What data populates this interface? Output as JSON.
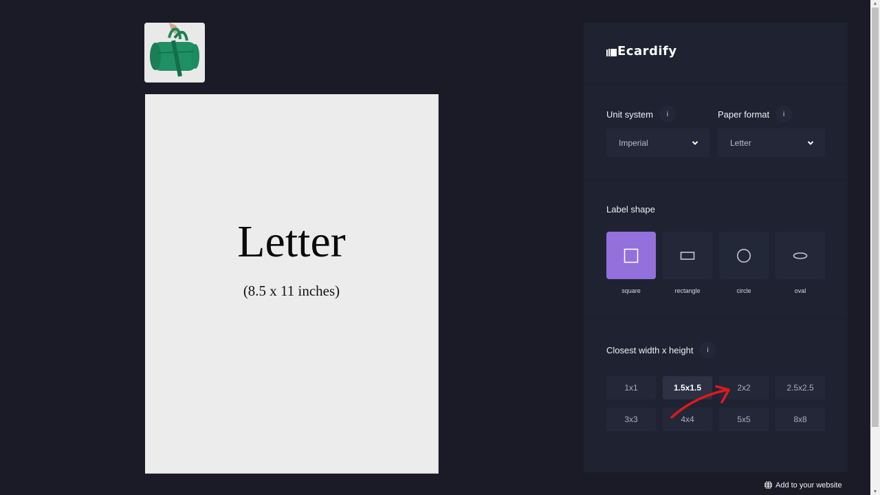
{
  "preview": {
    "thumbnail_alt": "green duffel bag product image",
    "paper_name": "Letter",
    "paper_dimensions": "(8.5 x 11 inches)"
  },
  "panel": {
    "brand": "Ecardify",
    "unit_system": {
      "label": "Unit system",
      "info": "i",
      "value": "Imperial"
    },
    "paper_format": {
      "label": "Paper format",
      "info": "i",
      "value": "Letter"
    },
    "label_shape": {
      "label": "Label shape",
      "selected": "square",
      "options": [
        {
          "id": "square",
          "label": "square"
        },
        {
          "id": "rectangle",
          "label": "rectangle"
        },
        {
          "id": "circle",
          "label": "circle"
        },
        {
          "id": "oval",
          "label": "oval"
        }
      ]
    },
    "closest_size": {
      "label": "Closest width x height",
      "info": "i",
      "selected": "1.5x1.5",
      "options": [
        "1x1",
        "1.5x1.5",
        "2x2",
        "2.5x2.5",
        "3x3",
        "4x4",
        "5x5",
        "8x8"
      ]
    },
    "accent_color": "#9370db"
  },
  "footer": {
    "add_to_website": "Add to your website"
  },
  "annotation": {
    "arrow_color": "#e0191e",
    "points_to": "2x2"
  }
}
